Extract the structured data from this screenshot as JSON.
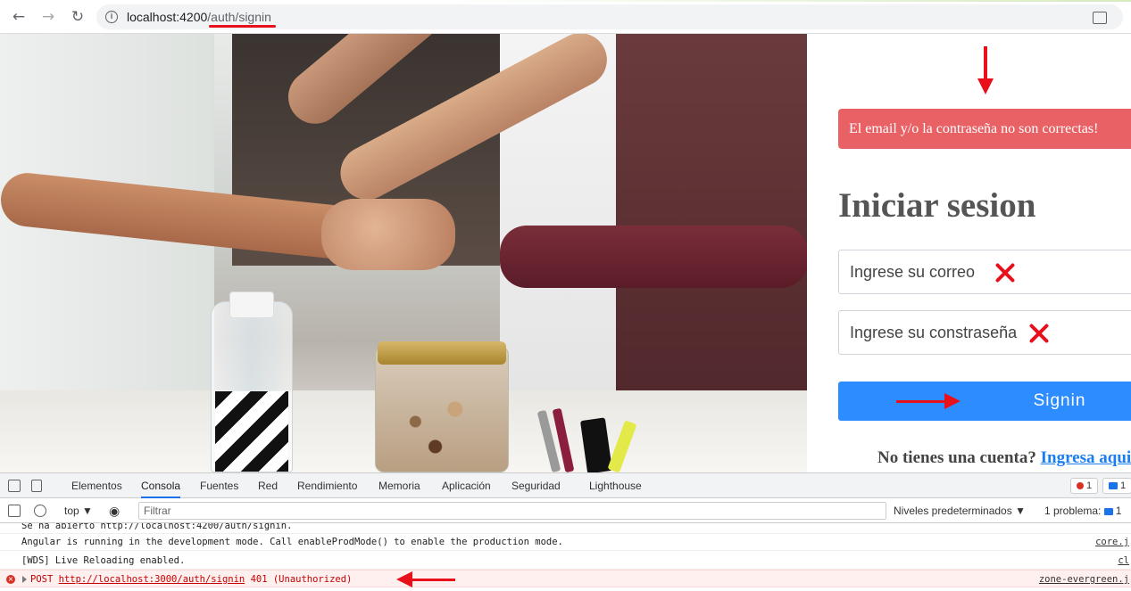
{
  "browser": {
    "url_host": "localhost:4200",
    "url_path": "/auth/signin",
    "nav_back": "←",
    "nav_forward": "→",
    "nav_reload": "↻",
    "info_glyph": "i"
  },
  "login": {
    "alert_text": "El email y/o la contraseña no son correctas!",
    "title": "Iniciar sesion",
    "email_placeholder": "Ingrese su correo",
    "password_placeholder": "Ingrese su constraseña",
    "signin_label": "Signin",
    "footer_question": "No tienes una cuenta?",
    "footer_link": "Ingresa aqui"
  },
  "devtools": {
    "tabs": [
      "Elementos",
      "Consola",
      "Fuentes",
      "Red",
      "Rendimiento",
      "Memoria",
      "Aplicación",
      "Seguridad",
      "Lighthouse"
    ],
    "active_tab": "Consola",
    "errors_badge": "1",
    "messages_badge": "1",
    "context": "top ▼",
    "filter_placeholder": "Filtrar",
    "levels": "Niveles predeterminados ▼",
    "problems": "1 problema:",
    "problems_count": "1",
    "console": [
      {
        "text": "Se ha abierto http://localhost:4200/auth/signin.",
        "source": ""
      },
      {
        "text": "Angular is running in the development mode. Call enableProdMode() to enable the production mode.",
        "source": "core.j"
      },
      {
        "text": "[WDS] Live Reloading enabled.",
        "source": "cl"
      },
      {
        "method": "POST",
        "url": "http://localhost:3000/auth/signin",
        "status": "401 (Unauthorized)",
        "source": "zone-evergreen.j"
      }
    ]
  },
  "colors": {
    "alert_bg": "#e86165",
    "button_bg": "#2d8cff",
    "annotation_red": "#e8101b",
    "link_blue": "#1a7df0"
  }
}
